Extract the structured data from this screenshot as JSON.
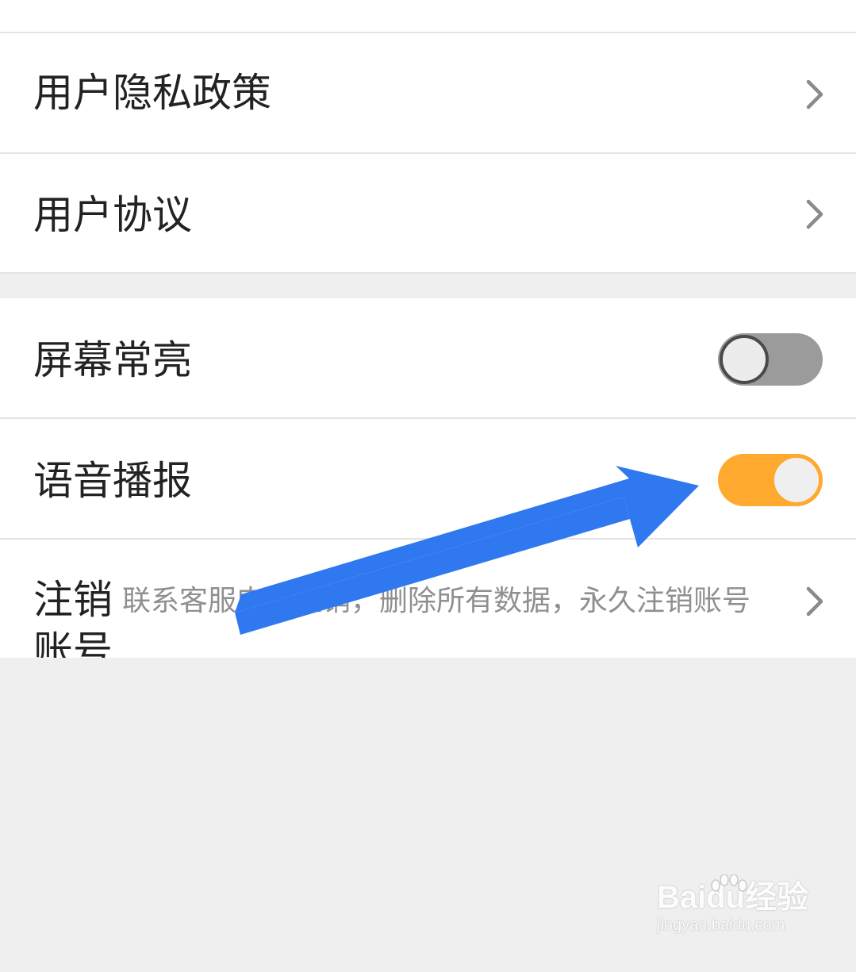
{
  "settings_group_1": {
    "items": [
      {
        "label": "用户隐私政策"
      },
      {
        "label": "用户协议"
      }
    ]
  },
  "settings_group_2": {
    "screen_on": {
      "label": "屏幕常亮",
      "enabled": false
    },
    "voice_broadcast": {
      "label": "语音播报",
      "enabled": true
    },
    "cancel_account": {
      "label_line1": "注销",
      "label_line2": "账号",
      "description": "联系客服申请注销，删除所有数据，永久注销账号"
    }
  },
  "colors": {
    "toggle_on": "#ffaa2e",
    "toggle_off": "#9b9b9b",
    "annotation_arrow": "#2f78ef"
  },
  "icons": {
    "chevron": "chevron-right-icon",
    "annotation": "arrow-annotation-icon",
    "watermark_logo": "baidu-paw-icon"
  },
  "watermark": {
    "brand": "Bai",
    "brand_suffix": "du",
    "product": "经验",
    "url": "jingyan.baidu.com"
  }
}
